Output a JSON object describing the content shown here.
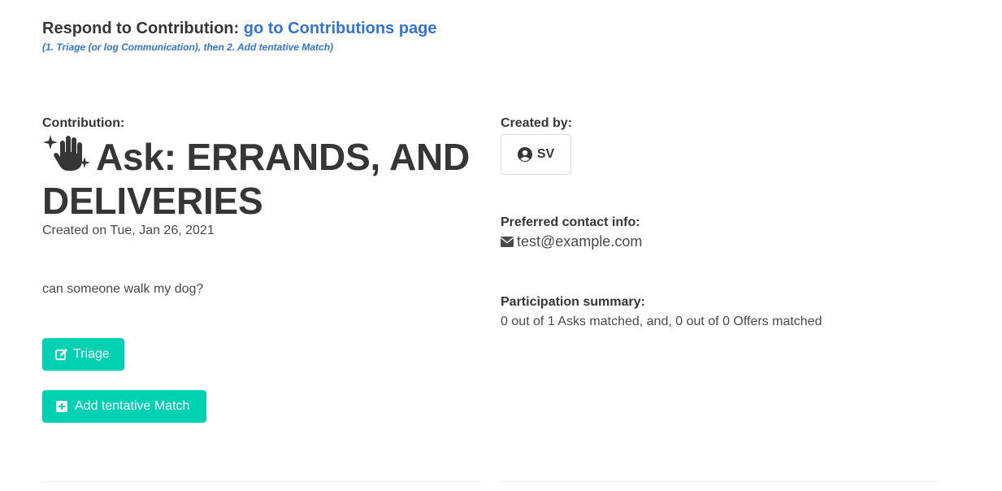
{
  "header": {
    "title_prefix": "Respond to Contribution:",
    "link_text": "go to Contributions page",
    "hint": "(1. Triage (or log Communication), then 2. Add tentative Match)"
  },
  "contribution": {
    "label": "Contribution:",
    "icon": "raised-hand-sparkles-icon",
    "title": "Ask: ERRANDS, AND DELIVERIES",
    "created_on": "Created on Tue, Jan 26, 2021",
    "description": "can someone walk my dog?"
  },
  "actions": {
    "triage_label": "Triage",
    "add_match_label": "Add tentative Match",
    "button_color": "#00d1b2"
  },
  "created_by": {
    "label": "Created by:",
    "name": "SV",
    "icon": "user-circle-icon"
  },
  "contact": {
    "label": "Preferred contact info:",
    "value": "test@example.com",
    "icon": "envelope-icon"
  },
  "participation": {
    "label": "Participation summary:",
    "value": "0 out of 1 Asks matched, and, 0 out of 0 Offers matched"
  },
  "colors": {
    "link": "#3273dc",
    "text": "#363636",
    "accent": "#00d1b2"
  }
}
